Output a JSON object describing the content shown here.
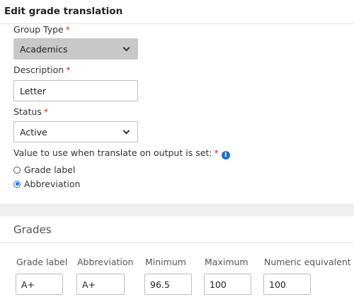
{
  "header": {
    "title": "Edit grade translation"
  },
  "form": {
    "group_type": {
      "label": "Group Type",
      "required": "*",
      "value": "Academics"
    },
    "description": {
      "label": "Description",
      "required": "*",
      "value": "Letter"
    },
    "status": {
      "label": "Status",
      "required": "*",
      "value": "Active"
    },
    "translate": {
      "label": "Value to use when translate on output is set:",
      "required": "*",
      "info_icon": "i",
      "options": [
        {
          "label": "Grade label",
          "checked": false
        },
        {
          "label": "Abbreviation",
          "checked": true
        }
      ]
    }
  },
  "grades": {
    "title": "Grades",
    "columns": [
      "Grade label",
      "Abbreviation",
      "Minimum",
      "Maximum",
      "Numeric equivalent"
    ],
    "rows": [
      {
        "grade_label": "A+",
        "abbreviation": "A+",
        "minimum": "96.5",
        "maximum": "100",
        "numeric_equivalent": "100"
      }
    ]
  },
  "icons": {
    "select_arrow": "chevron-down-icon",
    "info": "info-icon"
  },
  "colors": {
    "required": "#d9302c",
    "info": "#1f6fc4",
    "radio_selected": "#1a73e8"
  }
}
